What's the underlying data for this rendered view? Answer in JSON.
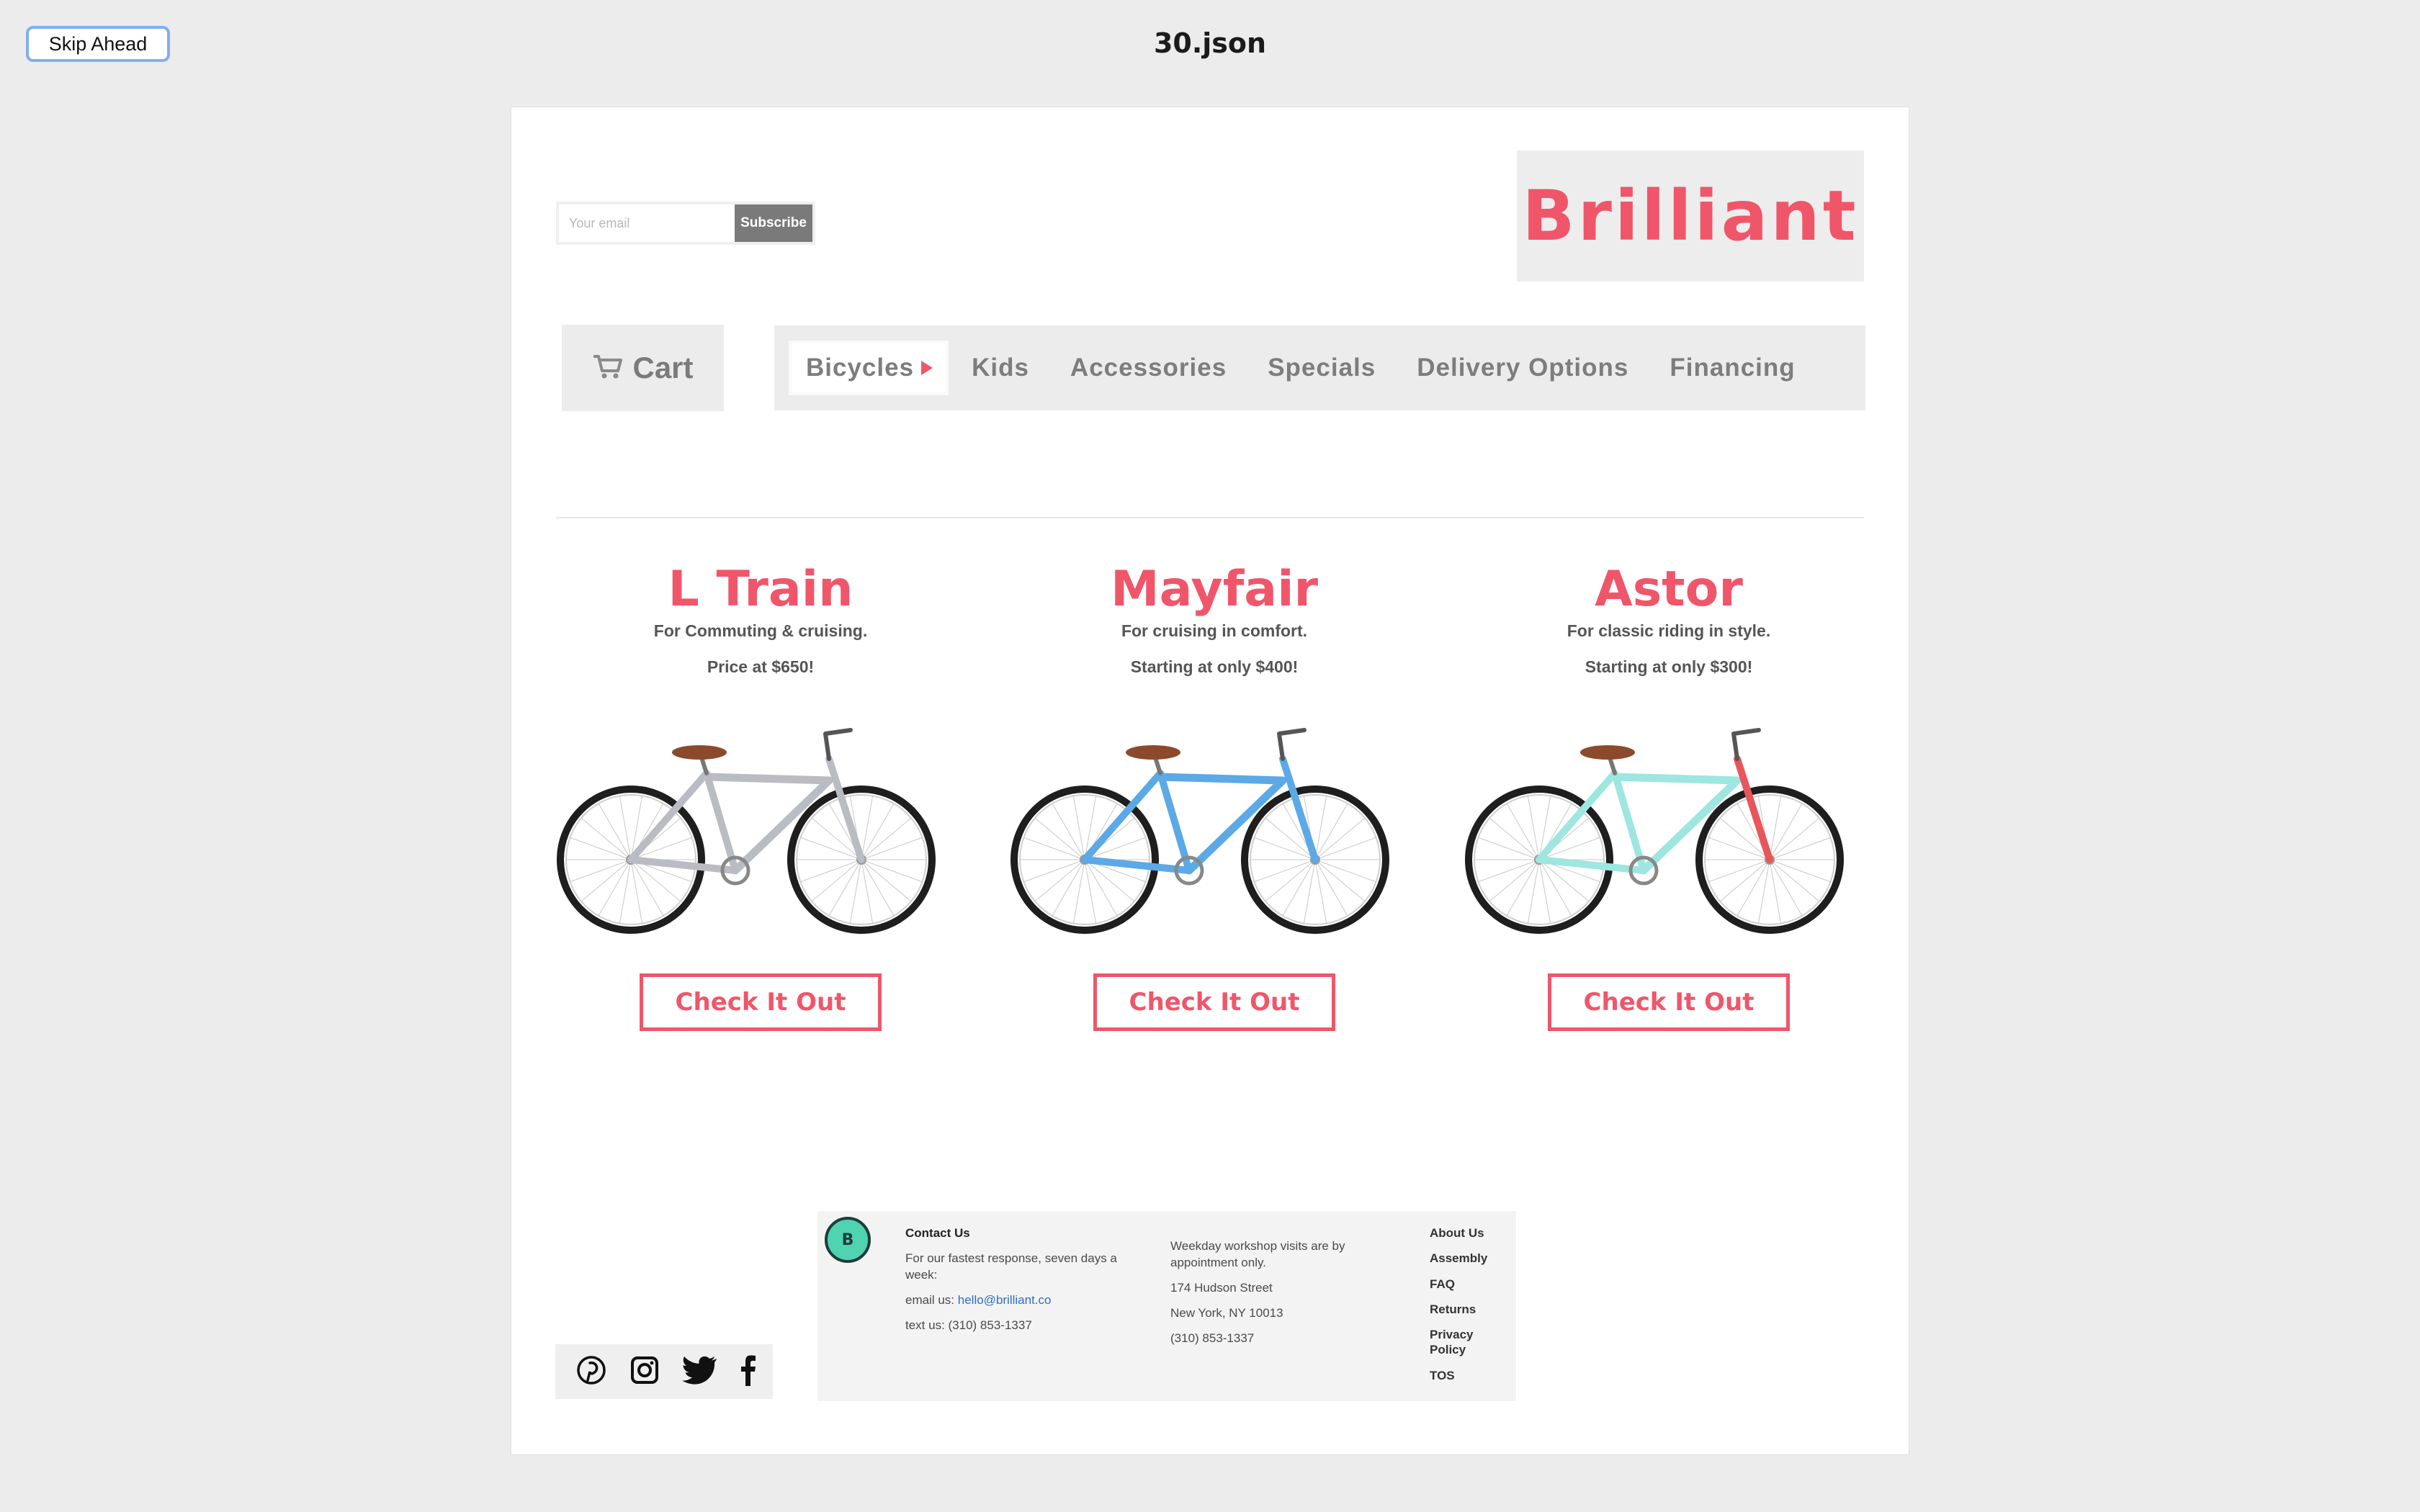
{
  "page": {
    "skip_label": "Skip Ahead",
    "file_title": "30.json"
  },
  "header": {
    "email_placeholder": "Your email",
    "subscribe_label": "Subscribe",
    "logo": "Brilliant",
    "cart_label": "Cart"
  },
  "nav": {
    "items": [
      {
        "label": "Bicycles"
      },
      {
        "label": "Kids"
      },
      {
        "label": "Accessories"
      },
      {
        "label": "Specials"
      },
      {
        "label": "Delivery Options"
      },
      {
        "label": "Financing"
      }
    ]
  },
  "products": [
    {
      "name": "L Train",
      "desc": "For Commuting & cruising.",
      "price": "Price at $650!",
      "cta": "Check It Out",
      "frame_color": "#b9bcc3",
      "accent_color": "#b9bcc3"
    },
    {
      "name": "Mayfair",
      "desc": "For cruising in comfort.",
      "price": "Starting at only $400!",
      "cta": "Check It Out",
      "frame_color": "#5ba9e6",
      "accent_color": "#5ba9e6"
    },
    {
      "name": "Astor",
      "desc": "For classic riding in style.",
      "price": "Starting at only $300!",
      "cta": "Check It Out",
      "frame_color": "#9ee6e0",
      "accent_color": "#e8565a"
    }
  ],
  "footer": {
    "logo_letter": "B",
    "contact_heading": "Contact Us",
    "contact_text": "For our fastest response, seven days a week:",
    "email_label": "email us:",
    "email_link": "hello@brilliant.co",
    "text_line": "text us: (310) 853-1337",
    "visits": "Weekday workshop visits are by appointment only.",
    "street": "174 Hudson Street",
    "city": "New York, NY 10013",
    "phone": "(310) 853-1337",
    "links": [
      "About Us",
      "Assembly",
      "FAQ",
      "Returns",
      "Privacy Policy",
      "TOS"
    ]
  },
  "colors": {
    "brand": "#f0566a",
    "background": "#ececec"
  }
}
